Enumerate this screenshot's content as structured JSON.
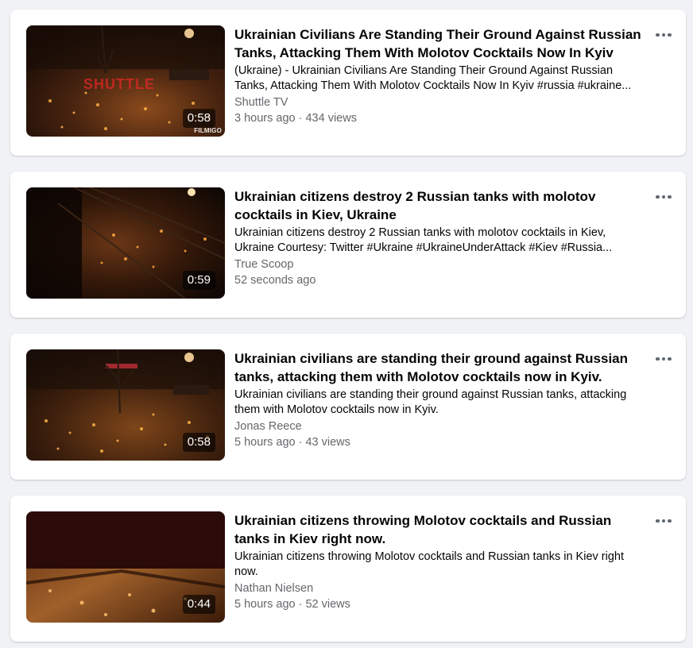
{
  "videos": [
    {
      "title": "Ukrainian Civilians Are Standing Their Ground Against Russian Tanks, Attacking Them With Molotov Cocktails Now In Kyiv",
      "description": "(Ukraine) - Ukrainian Civilians Are Standing Their Ground Against Russian Tanks, Attacking Them With Molotov Cocktails Now In Kyiv #russia #ukraine...",
      "channel": "Shuttle TV",
      "meta": "3 hours ago · 434 views",
      "duration": "0:58",
      "logo_text": "SHUTTLE",
      "watermark": "FILMIGO"
    },
    {
      "title": "Ukrainian citizens destroy 2 Russian tanks with molotov cocktails in Kiev, Ukraine",
      "description": "Ukrainian citizens destroy 2 Russian tanks with molotov cocktails in Kiev, Ukraine Courtesy: Twitter #Ukraine #UkraineUnderAttack #Kiev #Russia...",
      "channel": "True Scoop",
      "meta": "52 seconds ago",
      "duration": "0:59"
    },
    {
      "title": "Ukrainian civilians are standing their ground against Russian tanks, attacking them with Molotov cocktails now in Kyiv.",
      "description": "Ukrainian civilians are standing their ground against Russian tanks, attacking them with Molotov cocktails now in Kyiv.",
      "channel": "Jonas Reece",
      "meta": "5 hours ago · 43 views",
      "duration": "0:58"
    },
    {
      "title": "Ukrainian citizens throwing Molotov cocktails and Russian tanks in Kiev right now.",
      "description": "Ukrainian citizens throwing Molotov cocktails and Russian tanks in Kiev right now.",
      "channel": "Nathan Nielsen",
      "meta": "5 hours ago · 52 views",
      "duration": "0:44"
    }
  ],
  "icons": {
    "more": "more-options-icon"
  },
  "colors": {
    "page_bg": "#f0f2f5",
    "card_bg": "#ffffff",
    "title": "#050505",
    "secondary_text": "#65676b"
  }
}
